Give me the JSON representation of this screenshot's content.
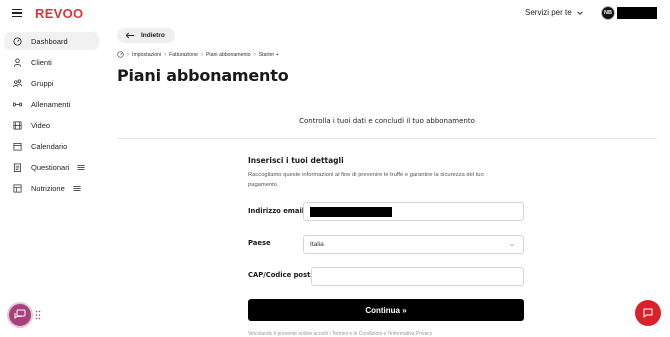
{
  "header": {
    "logo": "REVOO",
    "services_label": "Servizi per te",
    "user_initials": "NB"
  },
  "sidebar": {
    "items": [
      {
        "label": "Dashboard",
        "icon": "dashboard-gauge-icon",
        "active": true
      },
      {
        "label": "Clienti",
        "icon": "user-icon"
      },
      {
        "label": "Gruppi",
        "icon": "group-icon"
      },
      {
        "label": "Allenamenti",
        "icon": "dumbbell-icon"
      },
      {
        "label": "Video",
        "icon": "film-icon"
      },
      {
        "label": "Calendario",
        "icon": "calendar-icon"
      },
      {
        "label": "Questionari",
        "icon": "clipboard-icon",
        "tag_icon": "tag-icon"
      },
      {
        "label": "Nutrizione",
        "icon": "nutrition-icon",
        "tag_icon": "tag-icon"
      }
    ]
  },
  "main": {
    "back_label": "Indietro",
    "breadcrumb": [
      "Impostazioni",
      "Fatturazione",
      "Piani abbonamento",
      "Starter +"
    ],
    "title": "Piani abbonamento",
    "subtitle": "Controlla i tuoi dati e concludi il tuo abbonamento",
    "form": {
      "title": "Inserisci i tuoi dettagli",
      "description": "Raccogliamo queste informazioni al fine di prevenire le truffe e garantire la sicurezza del tuo pagamento.",
      "email_label": "Indirizzo email",
      "country_label": "Paese",
      "country_value": "Italia",
      "zip_label": "CAP/Codice postale",
      "zip_value": "",
      "submit_label": "Continua »"
    },
    "footer_text": "Veicolando il presente ordine accetti i Termini e le Condizioni e l'Informativa Privacy"
  },
  "colors": {
    "brand": "#e0303a",
    "chat_left": "#a6417a",
    "chat_right": "#d9232c"
  }
}
